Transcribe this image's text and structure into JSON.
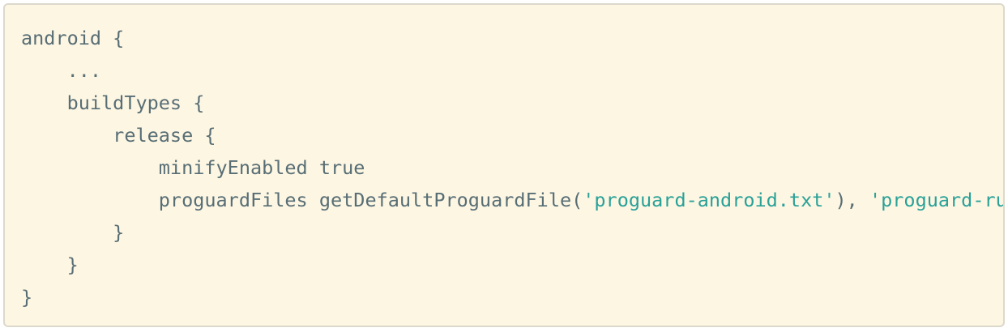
{
  "code_block": {
    "lines": [
      {
        "segments": [
          {
            "text": "android {",
            "type": "plain"
          }
        ]
      },
      {
        "segments": [
          {
            "text": "    ...",
            "type": "plain"
          }
        ]
      },
      {
        "segments": [
          {
            "text": "    buildTypes {",
            "type": "plain"
          }
        ]
      },
      {
        "segments": [
          {
            "text": "        release {",
            "type": "plain"
          }
        ]
      },
      {
        "segments": [
          {
            "text": "            minifyEnabled true",
            "type": "plain"
          }
        ]
      },
      {
        "segments": [
          {
            "text": "            proguardFiles getDefaultProguardFile(",
            "type": "plain"
          },
          {
            "text": "'proguard-android.txt'",
            "type": "string"
          },
          {
            "text": "), ",
            "type": "plain"
          },
          {
            "text": "'proguard-rules.pro'",
            "type": "string"
          }
        ]
      },
      {
        "segments": [
          {
            "text": "        }",
            "type": "plain"
          }
        ]
      },
      {
        "segments": [
          {
            "text": "    }",
            "type": "plain"
          }
        ]
      },
      {
        "segments": [
          {
            "text": "}",
            "type": "plain"
          }
        ]
      }
    ],
    "colors": {
      "background": "#fdf6e3",
      "border": "#dcd8cc",
      "text": "#586e75",
      "string": "#2aa198"
    }
  }
}
